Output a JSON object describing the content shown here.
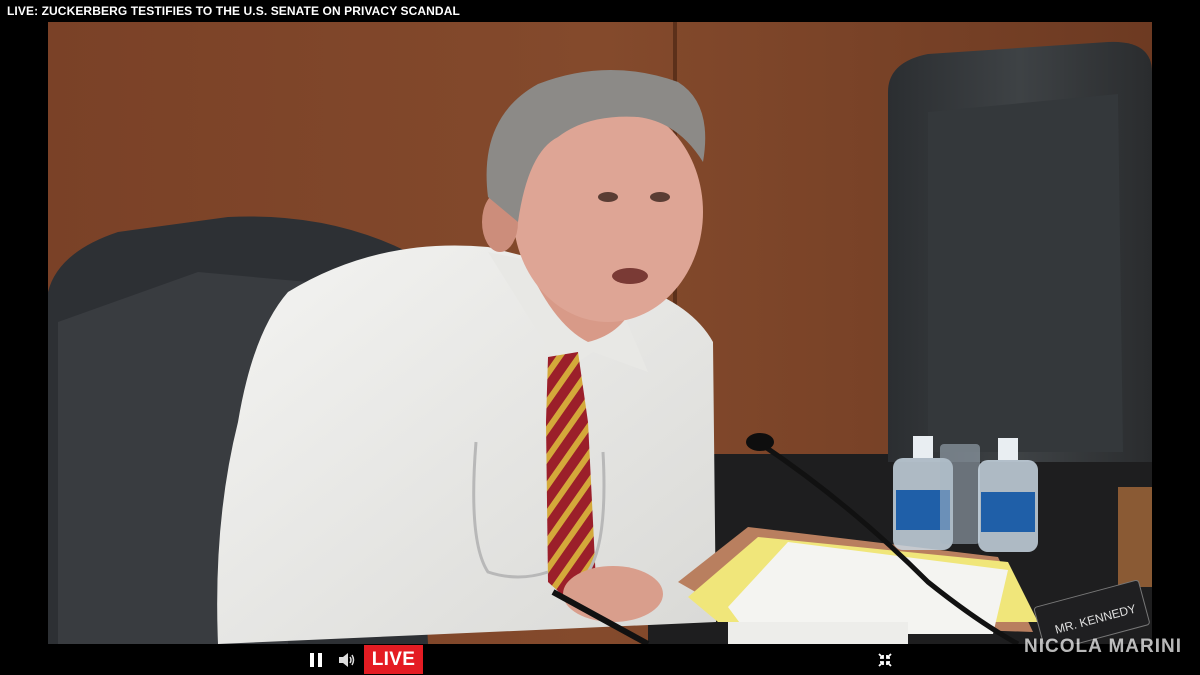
{
  "header": {
    "title": "LIVE: ZUCKERBERG TESTIFIES TO THE U.S. SENATE ON PRIVACY SCANDAL"
  },
  "video": {
    "nameplate": "MR. KENNEDY"
  },
  "controls": {
    "pause_icon": "pause-icon",
    "volume_icon": "speaker-icon",
    "live_label": "LIVE",
    "fullscreen_icon": "collapse-icon",
    "live_color": "#e41c23"
  },
  "watermark": {
    "text": "NICOLA MARINI"
  }
}
